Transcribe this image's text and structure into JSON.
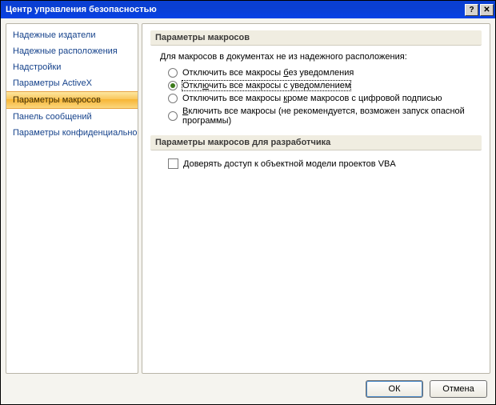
{
  "window": {
    "title": "Центр управления безопасностью"
  },
  "sidebar": {
    "items": [
      {
        "label": "Надежные издатели"
      },
      {
        "label": "Надежные расположения"
      },
      {
        "label": "Надстройки"
      },
      {
        "label": "Параметры ActiveX"
      },
      {
        "label": "Параметры макросов",
        "selected": true
      },
      {
        "label": "Панель сообщений"
      },
      {
        "label": "Параметры конфиденциальности"
      }
    ]
  },
  "main": {
    "section1": {
      "title": "Параметры макросов",
      "intro": "Для макросов в документах не из надежного расположения:",
      "options": [
        {
          "pre": "Отключить все макросы ",
          "u": "б",
          "post": "ез уведомления",
          "checked": false
        },
        {
          "pre": "Откл",
          "u": "ю",
          "post": "чить все макросы с уведомлением",
          "checked": true,
          "focused": true
        },
        {
          "pre": "Отключить все макросы ",
          "u": "к",
          "post": "роме макросов с цифровой подписью",
          "checked": false
        },
        {
          "pre": "",
          "u": "В",
          "post": "ключить все макросы (не рекомендуется, возможен запуск опасной программы)",
          "checked": false
        }
      ]
    },
    "section2": {
      "title": "Параметры макросов для разработчика",
      "checkbox": {
        "label": "Доверять доступ к объектной модели проектов VBA",
        "checked": false
      }
    }
  },
  "buttons": {
    "ok": "ОК",
    "cancel": "Отмена"
  }
}
